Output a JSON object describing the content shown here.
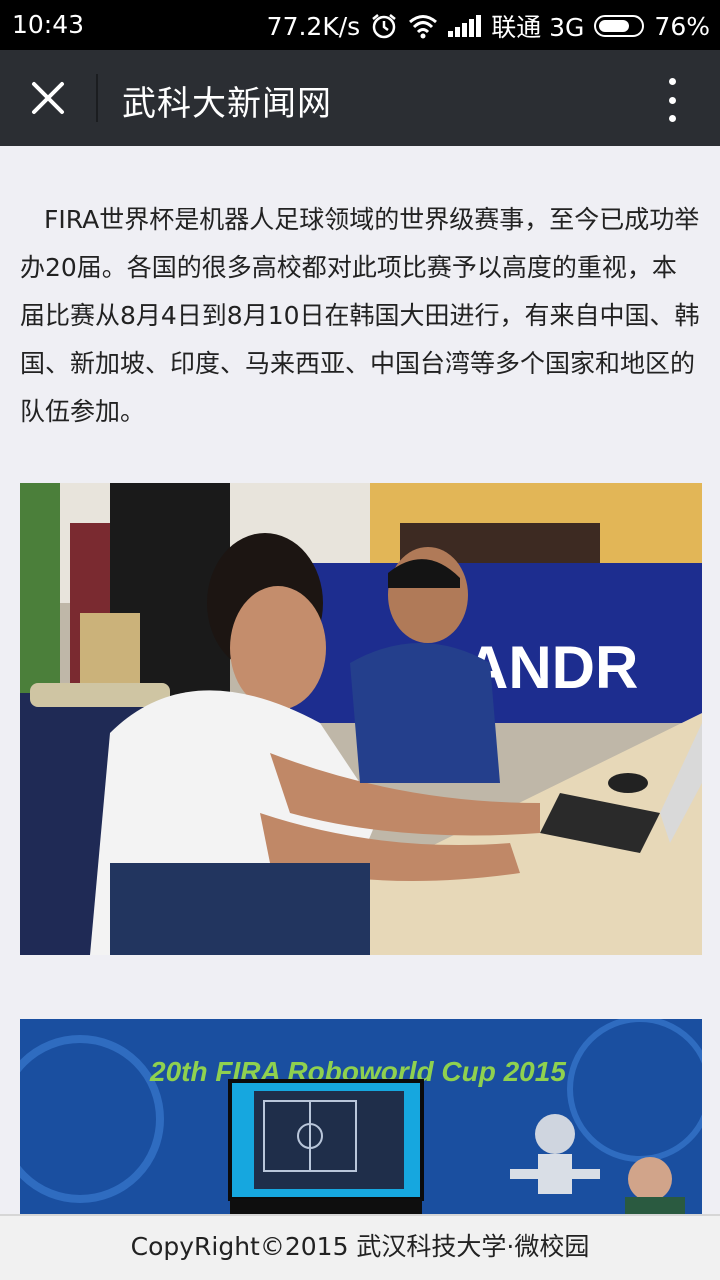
{
  "status_bar": {
    "time": "10:43",
    "net_speed": "77.2K/s",
    "carrier": "联通 3G",
    "battery": "76%",
    "battery_level": 0.76
  },
  "header": {
    "title": "武科大新闻网",
    "close_icon": "close-icon",
    "more_icon": "more-vertical-icon"
  },
  "article": {
    "paragraph": "FIRA世界杯是机器人足球领域的世界级赛事，至今已成功举办20届。各国的很多高校都对此项比赛予以高度的重视，本届比赛从8月4日到8月10日在韩国大田进行，有来自中国、韩国、新加坡、印度、马来西亚、中国台湾等多个国家和地区的队伍参加。",
    "photo1_banner_text": "ANDR",
    "photo2_banner_text": "20th FIRA Roboworld Cup 2015"
  },
  "footer": {
    "text": "CopyRight©2015 武汉科技大学·微校园"
  }
}
